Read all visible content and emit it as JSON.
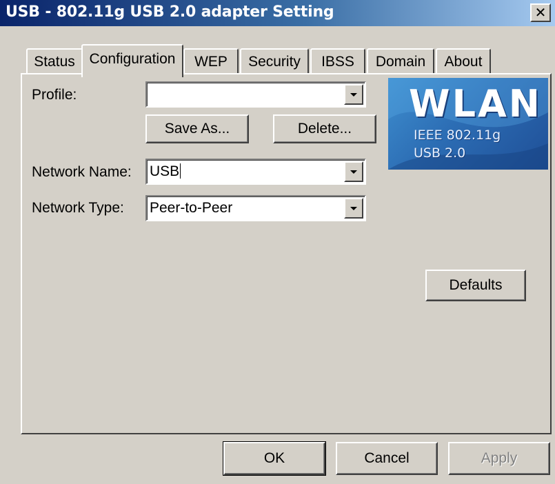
{
  "window": {
    "title": "USB - 802.11g USB 2.0 adapter Setting"
  },
  "tabs": [
    {
      "label": "Status"
    },
    {
      "label": "Configuration",
      "active": true
    },
    {
      "label": "WEP"
    },
    {
      "label": "Security"
    },
    {
      "label": "IBSS"
    },
    {
      "label": "Domain"
    },
    {
      "label": "About"
    }
  ],
  "form": {
    "profile_label": "Profile:",
    "profile_value": "",
    "save_as_label": "Save As...",
    "delete_label": "Delete...",
    "network_name_label": "Network Name:",
    "network_name_value": "USB",
    "network_type_label": "Network Type:",
    "network_type_value": "Peer-to-Peer",
    "defaults_label": "Defaults"
  },
  "logo": {
    "title": "WLAN",
    "line1": "IEEE 802.11g",
    "line2": "USB 2.0"
  },
  "buttons": {
    "ok": "OK",
    "cancel": "Cancel",
    "apply": "Apply"
  },
  "colors": {
    "titlebar_start": "#0a246a",
    "titlebar_end": "#a6caf0",
    "face": "#d4d0c8",
    "logo": "#2c6db4"
  },
  "icons": {
    "close": "close-icon",
    "dropdown": "chevron-down-icon"
  }
}
